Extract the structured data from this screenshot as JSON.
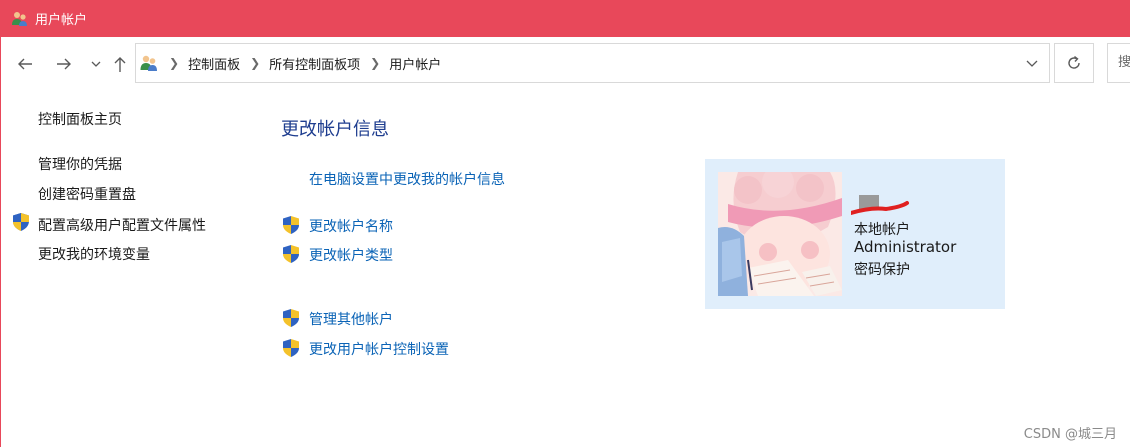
{
  "window": {
    "title": "用户帐户",
    "accent_color": "#e8485a"
  },
  "nav": {
    "back_icon": "arrow-left-icon",
    "forward_icon": "arrow-right-icon",
    "recent_icon": "chevron-down-icon",
    "up_icon": "arrow-up-icon",
    "breadcrumbs": [
      "控制面板",
      "所有控制面板项",
      "用户帐户"
    ],
    "search_placeholder": "搜"
  },
  "sidebar": {
    "home": "控制面板主页",
    "items": [
      {
        "label": "管理你的凭据",
        "shield": false
      },
      {
        "label": "创建密码重置盘",
        "shield": false
      },
      {
        "label": "配置高级用户配置文件属性",
        "shield": true
      },
      {
        "label": "更改我的环境变量",
        "shield": false
      }
    ]
  },
  "main": {
    "heading": "更改帐户信息",
    "pc_settings_link": "在电脑设置中更改我的帐户信息",
    "links": [
      {
        "label": "更改帐户名称",
        "shield": true
      },
      {
        "label": "更改帐户类型",
        "shield": true
      },
      {
        "label": "管理其他帐户",
        "shield": true
      },
      {
        "label": "更改用户帐户控制设置",
        "shield": true
      }
    ]
  },
  "account": {
    "type": "本地帐户",
    "name": "Administrator",
    "password_status": "密码保护",
    "card_color": "#e0eefb"
  },
  "watermark": "CSDN @城三月"
}
